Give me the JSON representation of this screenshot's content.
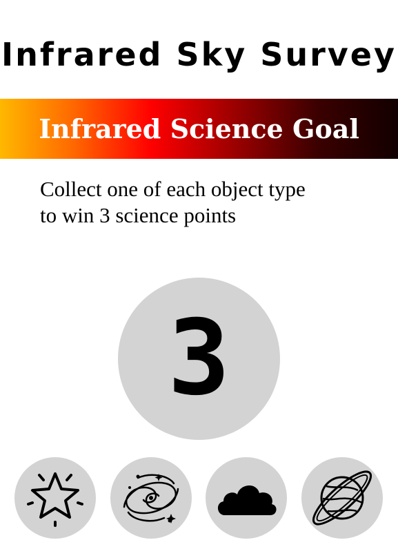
{
  "card": {
    "title": "Infrared Sky Survey",
    "banner": {
      "label": "Infrared Science Goal",
      "gradient_colors": [
        "#ffb800",
        "#ff6a00",
        "#ff0000",
        "#a00000",
        "#3a0000",
        "#120000"
      ]
    },
    "description_lines": [
      "Collect one of each object type",
      "to win 3 science points"
    ],
    "points": "3",
    "objects": [
      {
        "icon": "star-icon"
      },
      {
        "icon": "galaxy-icon"
      },
      {
        "icon": "cloud-icon"
      },
      {
        "icon": "planet-icon"
      }
    ]
  },
  "colors": {
    "circle_fill": "#d3d3d3",
    "text": "#000000",
    "banner_text": "#ffffff"
  }
}
